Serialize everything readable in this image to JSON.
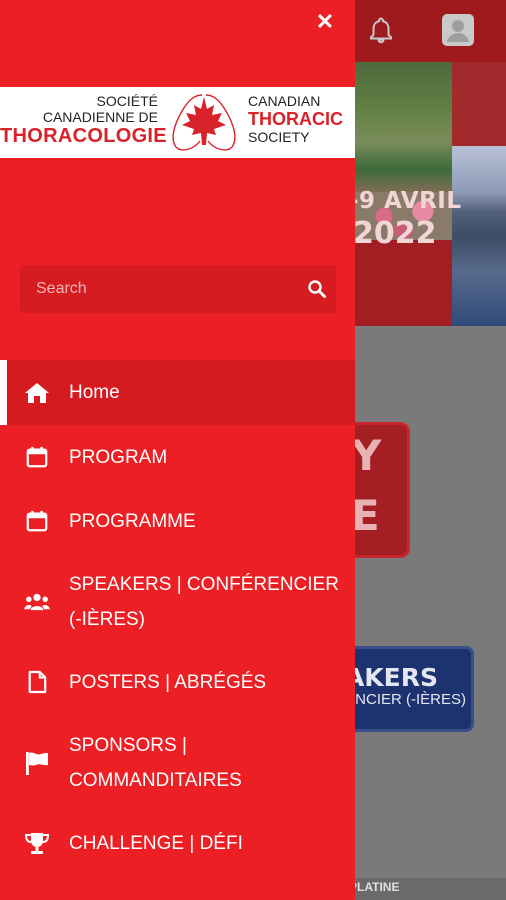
{
  "drawer": {
    "close_icon": "close-icon",
    "logo": {
      "fr_line1": "SOCIÉTÉ",
      "fr_line2": "CANADIENNE DE",
      "fr_line3": "THORACOLOGIE",
      "en_line1": "CANADIAN",
      "en_line2": "THORACIC",
      "en_line3": "SOCIETY"
    },
    "search": {
      "placeholder": "Search",
      "value": "",
      "icon": "search-icon"
    },
    "menu": [
      {
        "label": "Home",
        "icon": "home-icon",
        "active": true
      },
      {
        "label": "PROGRAM",
        "icon": "calendar-icon"
      },
      {
        "label": "PROGRAMME",
        "icon": "calendar-icon"
      },
      {
        "label_line1": "SPEAKERS | CONFÉRENCIER",
        "label_line2": "(-IÈRES)",
        "icon": "users-icon"
      },
      {
        "label": "POSTERS | ABRÉGÉS",
        "icon": "document-icon"
      },
      {
        "label_line1": "SPONSORS |",
        "label_line2": "COMMANDITAIRES",
        "icon": "flag-icon"
      },
      {
        "label": "CHALLENGE | DÉFI",
        "icon": "trophy-icon"
      }
    ]
  },
  "background": {
    "date_line1": "-9 AVRIL",
    "date_line2": "2022",
    "card1_line1": "Y",
    "card1_line2": "E",
    "card2_line1": "AKERS",
    "card2_line2": "NCIER (-IÈRES)",
    "strip_label": "PLATINE"
  },
  "colors": {
    "drawer": "#ec1f25",
    "drawer_active": "#d51a20",
    "header": "#9e1a1d"
  }
}
